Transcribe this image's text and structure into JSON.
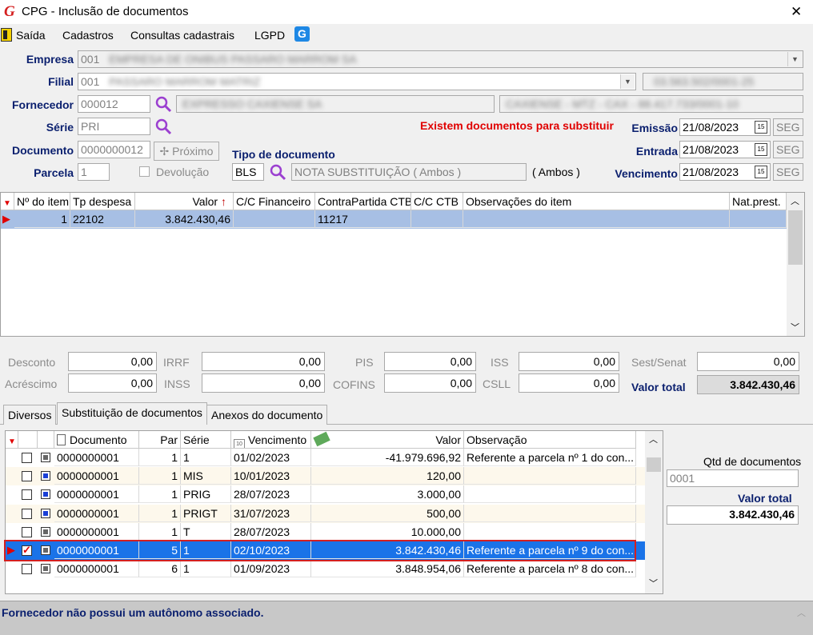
{
  "window": {
    "title": "CPG - Inclusão de documentos",
    "close": "✕"
  },
  "menu": {
    "items": [
      "Saída",
      "Cadastros",
      "Consultas cadastrais",
      "LGPD"
    ]
  },
  "form": {
    "empresa_label": "Empresa",
    "empresa_value": "001",
    "empresa_name": "EMPRESA DE ONIBUS PASSARO MARROM SA",
    "filial_label": "Filial",
    "filial_value": "001",
    "filial_name": "PASSARO MARROM MATRIZ",
    "filial_cnpj": "03.563.502/0001-25",
    "fornecedor_label": "Fornecedor",
    "fornecedor_value": "000012",
    "fornecedor_name": "EXPRESSO CAXIENSE SA",
    "fornecedor_extra": "CAXIENSE - MTZ - CAX - 88.417.733/0001-10",
    "serie_label": "Série",
    "serie_value": "PRI",
    "warning": "Existem documentos para substituir",
    "emissao_label": "Emissão",
    "emissao_value": "21/08/2023",
    "emissao_day": "SEG",
    "documento_label": "Documento",
    "documento_value": "0000000012",
    "proximo_label": "Próximo",
    "tipo_label": "Tipo de documento",
    "entrada_label": "Entrada",
    "entrada_value": "21/08/2023",
    "entrada_day": "SEG",
    "parcela_label": "Parcela",
    "parcela_value": "1",
    "devolucao_label": "Devolução",
    "tipo_code": "BLS",
    "tipo_desc": "NOTA SUBSTITUIÇÃO ( Ambos )",
    "tipo_ambos": "( Ambos )",
    "vencimento_label": "Vencimento",
    "vencimento_value": "21/08/2023",
    "vencimento_day": "SEG"
  },
  "items_grid": {
    "headers": [
      "Nº do item",
      "Tp despesa",
      "Valor",
      "C/C Financeiro",
      "ContraPartida CTB",
      "C/C CTB",
      "Observações do item",
      "Nat.prest."
    ],
    "rows": [
      [
        "1",
        "22102",
        "3.842.430,46",
        "",
        "11217",
        "",
        "",
        ""
      ]
    ]
  },
  "totals": {
    "desconto_label": "Desconto",
    "desconto": "0,00",
    "irrf_label": "IRRF",
    "irrf": "0,00",
    "pis_label": "PIS",
    "pis": "0,00",
    "iss_label": "ISS",
    "iss": "0,00",
    "sest_label": "Sest/Senat",
    "sest": "0,00",
    "acrescimo_label": "Acréscimo",
    "acrescimo": "0,00",
    "inss_label": "INSS",
    "inss": "0,00",
    "cofins_label": "COFINS",
    "cofins": "0,00",
    "csll_label": "CSLL",
    "csll": "0,00",
    "valor_total_label": "Valor total",
    "valor_total": "3.842.430,46"
  },
  "tabs": [
    "Diversos",
    "Substituição de documentos",
    "Anexos do documento"
  ],
  "subst_grid": {
    "headers": [
      "Documento",
      "Par",
      "Série",
      "Vencimento",
      "Valor",
      "Observação"
    ],
    "rows": [
      {
        "checked": false,
        "color": "gray",
        "doc": "0000000001",
        "par": "1",
        "serie": "1",
        "venc": "01/02/2023",
        "valor": "-41.979.696,92",
        "obs": "Referente a parcela nº 1 do con...",
        "selected": false
      },
      {
        "checked": false,
        "color": "blue",
        "doc": "0000000001",
        "par": "1",
        "serie": "MIS",
        "venc": "10/01/2023",
        "valor": "120,00",
        "obs": "",
        "selected": false
      },
      {
        "checked": false,
        "color": "blue",
        "doc": "0000000001",
        "par": "1",
        "serie": "PRIG",
        "venc": "28/07/2023",
        "valor": "3.000,00",
        "obs": "",
        "selected": false
      },
      {
        "checked": false,
        "color": "blue",
        "doc": "0000000001",
        "par": "1",
        "serie": "PRIGT",
        "venc": "31/07/2023",
        "valor": "500,00",
        "obs": "",
        "selected": false
      },
      {
        "checked": false,
        "color": "gray",
        "doc": "0000000001",
        "par": "1",
        "serie": "T",
        "venc": "28/07/2023",
        "valor": "10.000,00",
        "obs": "",
        "selected": false
      },
      {
        "checked": true,
        "color": "gray",
        "doc": "0000000001",
        "par": "5",
        "serie": "1",
        "venc": "02/10/2023",
        "valor": "3.842.430,46",
        "obs": "Referente a parcela nº 9 do con...",
        "selected": true
      },
      {
        "checked": false,
        "color": "gray",
        "doc": "0000000001",
        "par": "6",
        "serie": "1",
        "venc": "01/09/2023",
        "valor": "3.848.954,06",
        "obs": "Referente a parcela nº 8 do con...",
        "selected": false
      }
    ]
  },
  "side": {
    "qtd_label": "Qtd de documentos",
    "qtd_value": "0001",
    "valor_total_label": "Valor total",
    "valor_total": "3.842.430,46"
  },
  "status": {
    "message": "Fornecedor não possui um autônomo associado."
  }
}
